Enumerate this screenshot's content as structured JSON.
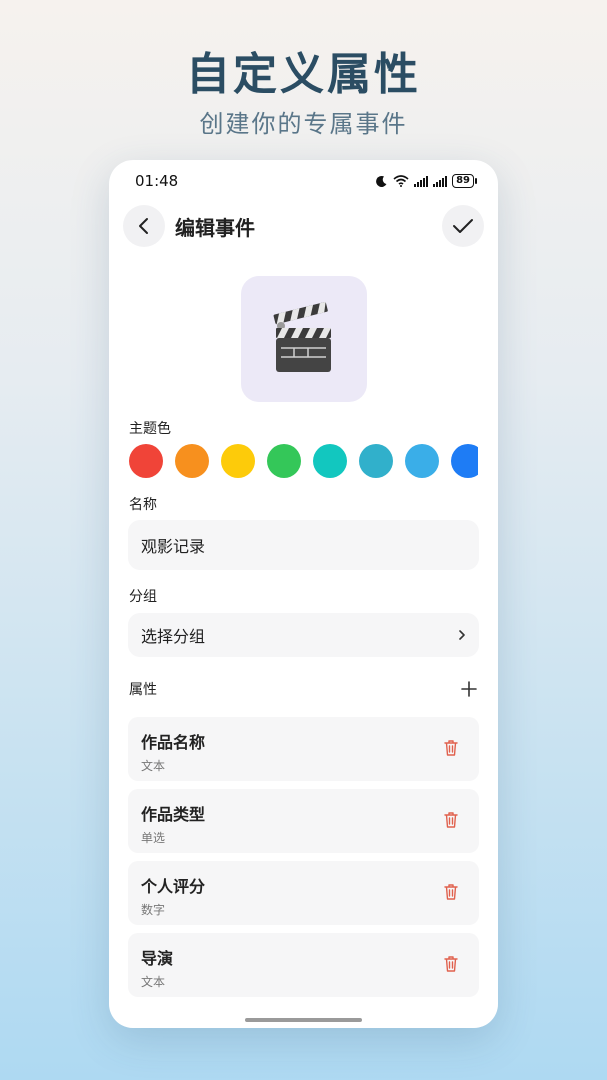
{
  "promo": {
    "headline": "自定义属性",
    "subline": "创建你的专属事件"
  },
  "statusbar": {
    "time": "01:48",
    "battery": "89",
    "icons": [
      "moon-icon",
      "wifi-icon",
      "signal-icon",
      "signal-icon",
      "battery-icon"
    ]
  },
  "header": {
    "title": "编辑事件",
    "back_icon": "chevron-left-icon",
    "confirm_icon": "check-icon"
  },
  "cover": {
    "icon": "clapperboard-icon"
  },
  "theme": {
    "label": "主题色",
    "colors": [
      "#f04438",
      "#f7901e",
      "#fdcb0a",
      "#34c759",
      "#12c7bf",
      "#31b0cb",
      "#3aaee8",
      "#1e7cf5"
    ]
  },
  "name": {
    "label": "名称",
    "value": "观影记录"
  },
  "group": {
    "label": "分组",
    "value": "选择分组"
  },
  "attributes": {
    "label": "属性",
    "items": [
      {
        "name": "作品名称",
        "type": "文本"
      },
      {
        "name": "作品类型",
        "type": "单选"
      },
      {
        "name": "个人评分",
        "type": "数字"
      },
      {
        "name": "导演",
        "type": "文本"
      }
    ]
  },
  "colors": {
    "headline": "#2b4d63",
    "danger": "#e0604d"
  }
}
